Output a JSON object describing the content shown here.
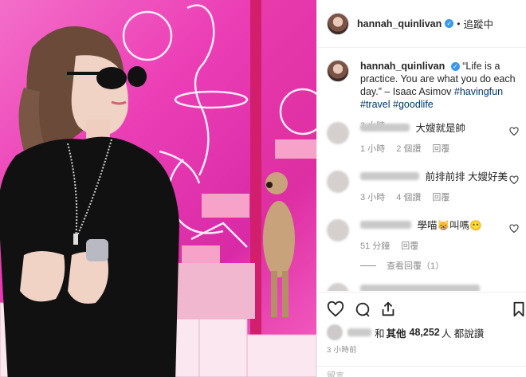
{
  "post": {
    "username": "hannah_quinlivan",
    "verified_icon": "verified-badge-icon",
    "dot": "•",
    "follow_label": "追蹤中"
  },
  "caption": {
    "username": "hannah_quinlivan",
    "text": "“Life is a practice. You are what you do each day.” – Isaac Asimov",
    "hashtags": [
      "#havingfun",
      "#travel",
      "#goodlife"
    ],
    "time": "3 小時"
  },
  "comments": [
    {
      "text": "大嫂就是帥",
      "time": "1 小時",
      "likes": "2 個讚",
      "reply": "回覆"
    },
    {
      "text": "前排前排 大嫂好美",
      "time": "3 小時",
      "likes": "4 個讚",
      "reply": "回覆"
    },
    {
      "text": "學喵😸叫嗎😶",
      "time": "51 分鐘",
      "likes": "",
      "reply": "回覆"
    }
  ],
  "view_replies": "查看回覆（1）",
  "actions": {
    "icons": [
      "heart-icon",
      "comment-icon",
      "share-icon",
      "bookmark-icon"
    ]
  },
  "likes": {
    "prefix": "和",
    "others_label": "其他",
    "count": "48,252",
    "suffix": "人 都說讚"
  },
  "post_time": "3 小時前",
  "add_comment_placeholder": "留言……",
  "colors": {
    "link": "#00376b",
    "verified": "#3897f0",
    "photo_pink": "#ec3fb6"
  }
}
